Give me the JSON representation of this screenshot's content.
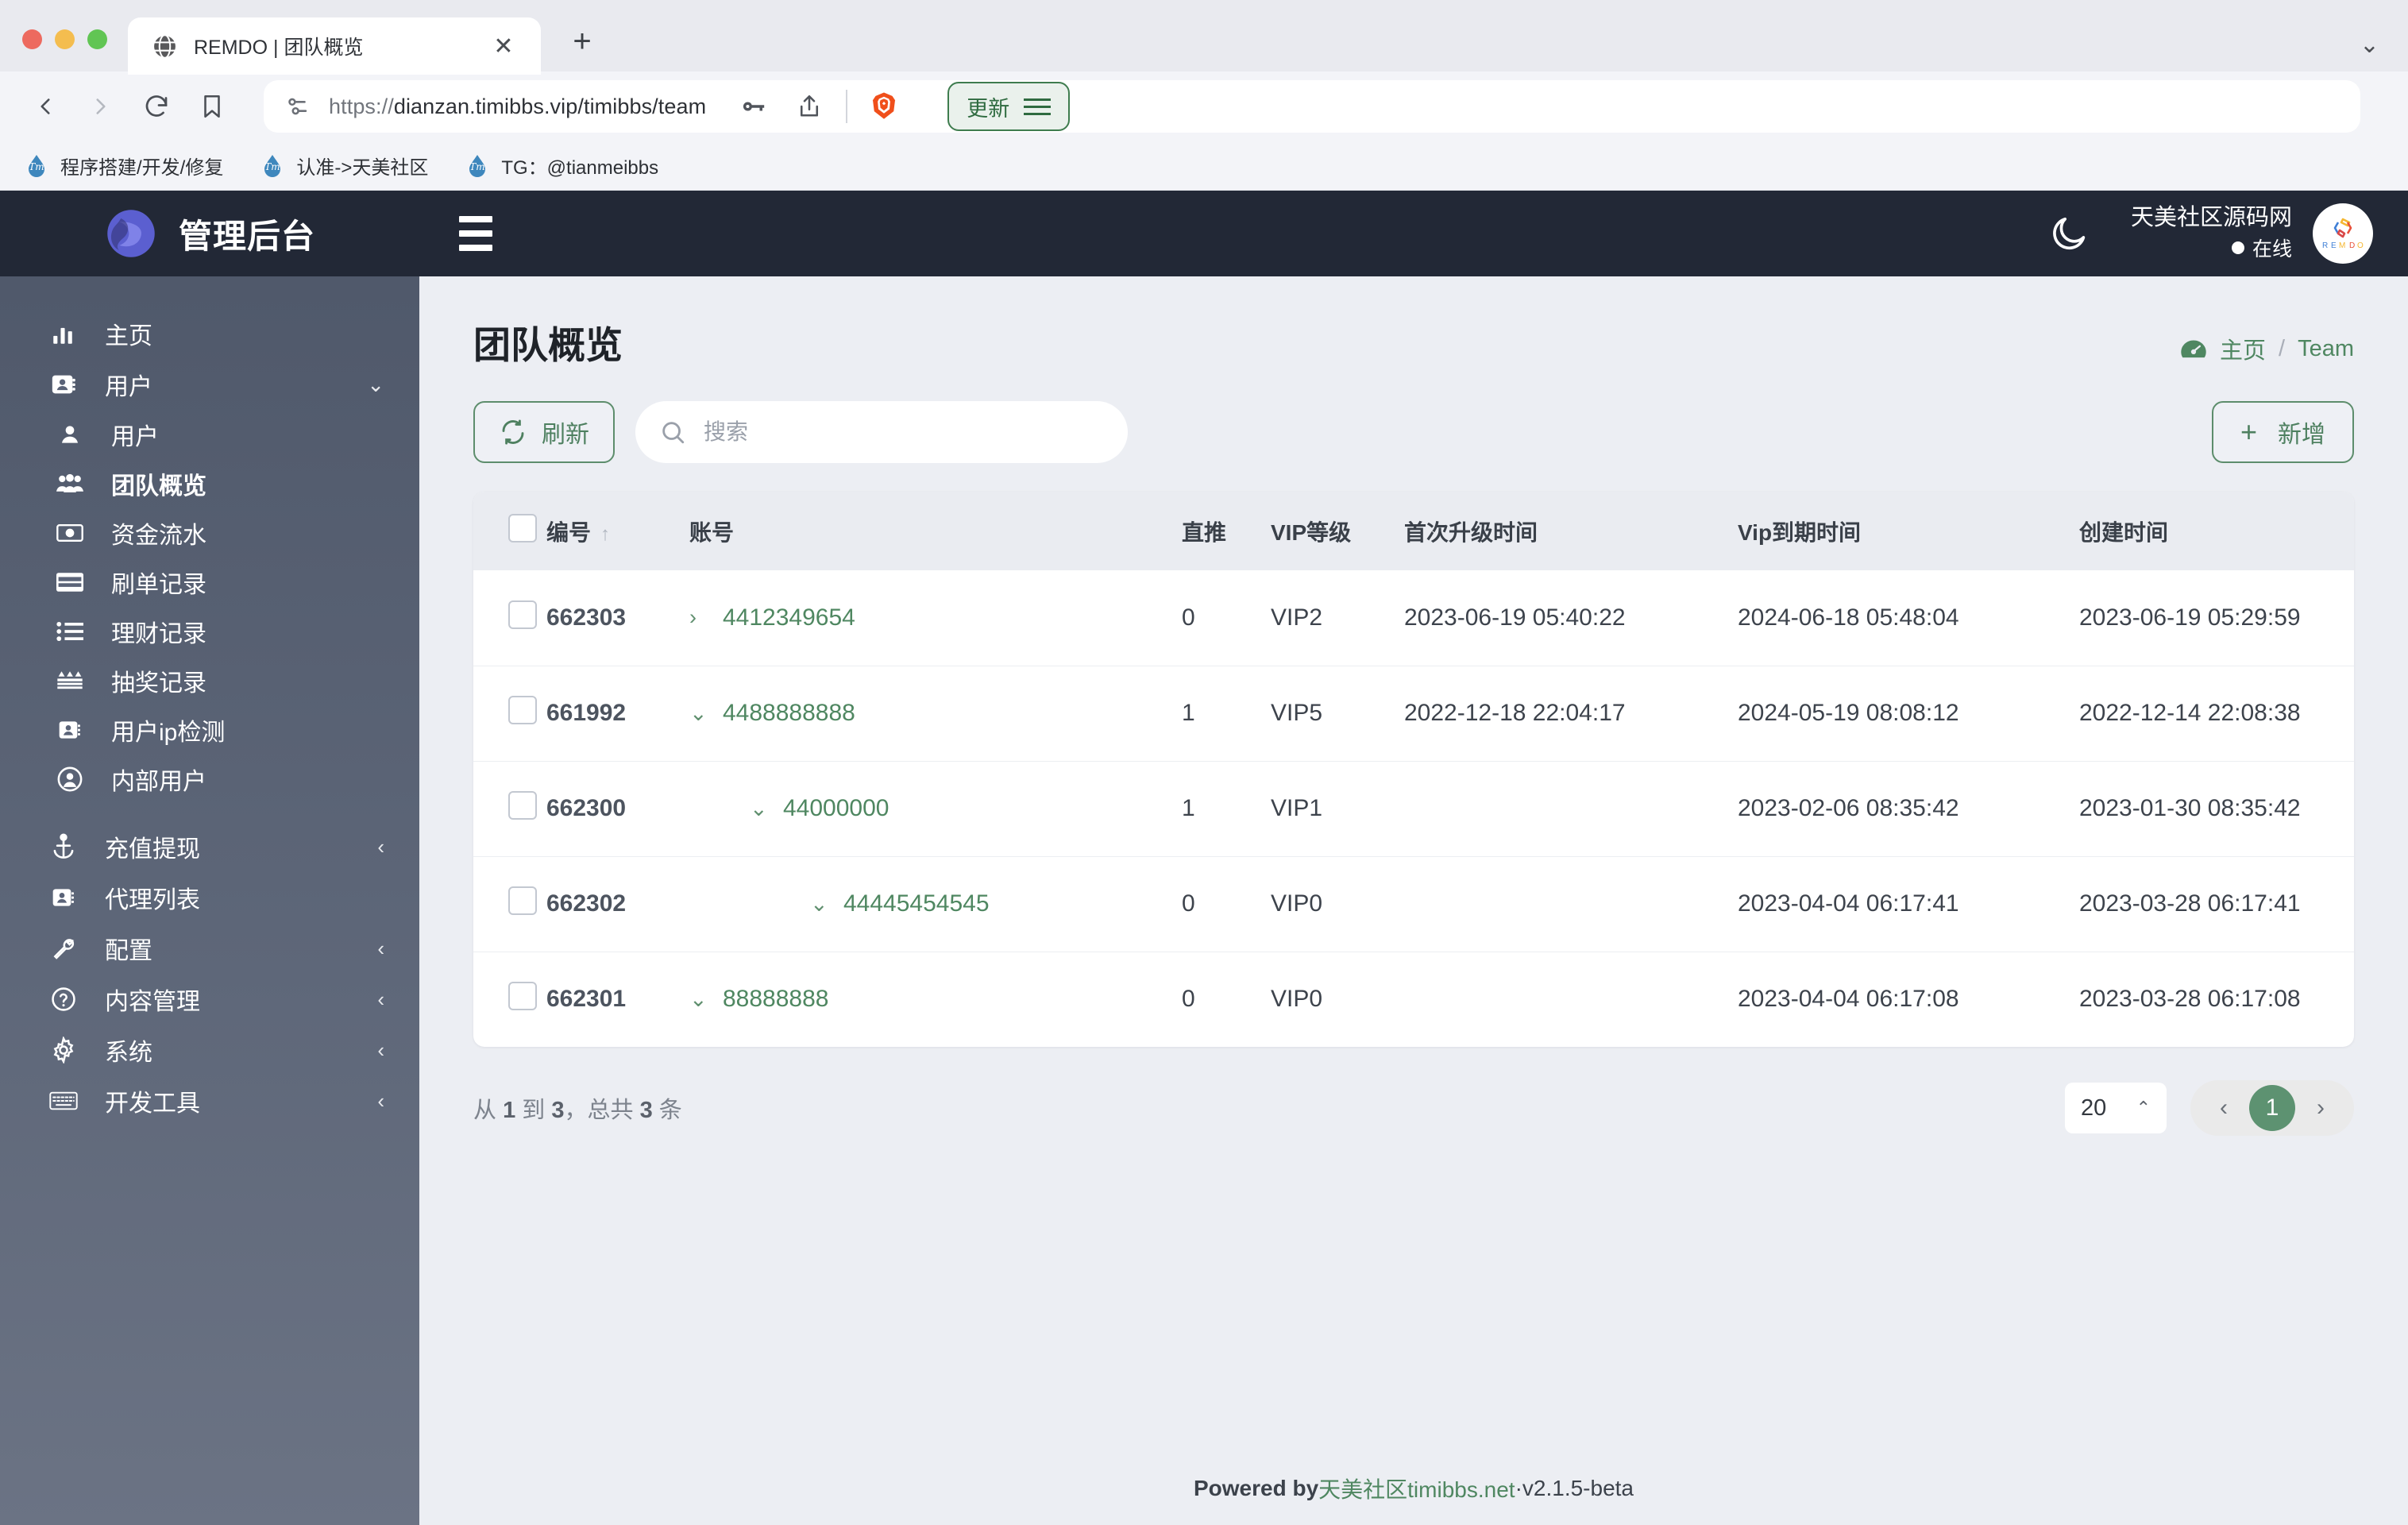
{
  "browser": {
    "tab": {
      "title": "REMDO | 团队概览",
      "close_label": "✕",
      "new_tab_label": "+"
    },
    "tabstrip_menu": "⌄",
    "url": {
      "scheme": "https://",
      "rest": "dianzan.timibbs.vip/timibbs/team"
    },
    "update_button": "更新",
    "bookmarks": [
      {
        "label": "程序搭建/开发/修复"
      },
      {
        "label": "认准->天美社区"
      },
      {
        "label": "TG：@tianmeibbs"
      }
    ]
  },
  "sidebar": {
    "brand": "管理后台",
    "items": [
      {
        "label": "主页",
        "icon": "chart-bars-icon",
        "level": "top",
        "arrow": ""
      },
      {
        "label": "用户",
        "icon": "contact-card-icon",
        "level": "top",
        "arrow": "⌄"
      },
      {
        "label": "用户",
        "icon": "user-icon",
        "level": "sub",
        "arrow": ""
      },
      {
        "label": "团队概览",
        "icon": "users-group-icon",
        "level": "sub",
        "arrow": "",
        "active": true
      },
      {
        "label": "资金流水",
        "icon": "money-bill-icon",
        "level": "sub",
        "arrow": ""
      },
      {
        "label": "刷单记录",
        "icon": "credit-card-icon",
        "level": "sub",
        "arrow": ""
      },
      {
        "label": "理财记录",
        "icon": "list-icon",
        "level": "sub",
        "arrow": ""
      },
      {
        "label": "抽奖记录",
        "icon": "lottery-icon",
        "level": "sub",
        "arrow": ""
      },
      {
        "label": "用户ip检测",
        "icon": "contact-card-icon",
        "level": "sub",
        "arrow": ""
      },
      {
        "label": "内部用户",
        "icon": "user-circle-icon",
        "level": "sub",
        "arrow": ""
      },
      {
        "label": "充值提现",
        "icon": "anchor-icon",
        "level": "top",
        "arrow": "‹"
      },
      {
        "label": "代理列表",
        "icon": "contact-card-icon",
        "level": "top",
        "arrow": ""
      },
      {
        "label": "配置",
        "icon": "wrench-icon",
        "level": "top",
        "arrow": "‹"
      },
      {
        "label": "内容管理",
        "icon": "question-circle-icon",
        "level": "top",
        "arrow": "‹"
      },
      {
        "label": "系统",
        "icon": "gear-icon",
        "level": "top",
        "arrow": "‹"
      },
      {
        "label": "开发工具",
        "icon": "keyboard-icon",
        "level": "top",
        "arrow": "‹"
      }
    ]
  },
  "topbar": {
    "user_name": "天美社区源码网",
    "status": "在线",
    "avatar_text": "REMDO"
  },
  "page": {
    "title": "团队概览",
    "breadcrumb": {
      "home": "主页",
      "separator": "/",
      "current": "Team"
    }
  },
  "toolbar": {
    "refresh_label": "刷新",
    "search_placeholder": "搜索",
    "search_value": "",
    "add_label": "新增",
    "add_plus": "+"
  },
  "table": {
    "columns": [
      {
        "key": "check",
        "label": ""
      },
      {
        "key": "id",
        "label": "编号",
        "sort": "↑"
      },
      {
        "key": "acct",
        "label": "账号"
      },
      {
        "key": "direct",
        "label": "直推"
      },
      {
        "key": "vip",
        "label": "VIP等级"
      },
      {
        "key": "first",
        "label": "首次升级时间"
      },
      {
        "key": "expire",
        "label": "Vip到期时间"
      },
      {
        "key": "create",
        "label": "创建时间"
      }
    ],
    "rows": [
      {
        "id": "662303",
        "chevron": "›",
        "indent": 0,
        "account": "4412349654",
        "direct": "0",
        "vip": "VIP2",
        "first_upgrade": "2023-06-19 05:40:22",
        "vip_expire": "2024-06-18 05:48:04",
        "created": "2023-06-19 05:29:59"
      },
      {
        "id": "661992",
        "chevron": "⌄",
        "indent": 0,
        "account": "4488888888",
        "direct": "1",
        "vip": "VIP5",
        "first_upgrade": "2022-12-18 22:04:17",
        "vip_expire": "2024-05-19 08:08:12",
        "created": "2022-12-14 22:08:38"
      },
      {
        "id": "662300",
        "chevron": "⌄",
        "indent": 1,
        "account": "44000000",
        "direct": "1",
        "vip": "VIP1",
        "first_upgrade": "",
        "vip_expire": "2023-02-06 08:35:42",
        "created": "2023-01-30 08:35:42"
      },
      {
        "id": "662302",
        "chevron": "⌄",
        "indent": 2,
        "account": "44445454545",
        "direct": "0",
        "vip": "VIP0",
        "first_upgrade": "",
        "vip_expire": "2023-04-04 06:17:41",
        "created": "2023-03-28 06:17:41"
      },
      {
        "id": "662301",
        "chevron": "⌄",
        "indent": 0,
        "account": "88888888",
        "direct": "0",
        "vip": "VIP0",
        "first_upgrade": "",
        "vip_expire": "2023-04-04 06:17:08",
        "created": "2023-03-28 06:17:08"
      }
    ]
  },
  "pagination": {
    "info_prefix": "从",
    "info_from": "1",
    "info_mid": "到",
    "info_to": "3",
    "info_comma": "，总共",
    "info_total": "3",
    "info_suffix": "条",
    "per_page": "20",
    "per_page_caret": "⌃",
    "prev": "‹",
    "current_page": "1",
    "next": "›"
  },
  "footer": {
    "powered": "Powered by ",
    "link": "天美社区timibbs.net",
    "dot": " · ",
    "version": "v2.1.5-beta"
  },
  "colors": {
    "sidebar_top": "#4e5769",
    "sidebar_bottom": "#6b7384",
    "header_dark": "#222836",
    "accent_green": "#4f8761",
    "page_bg": "#eceef3"
  }
}
